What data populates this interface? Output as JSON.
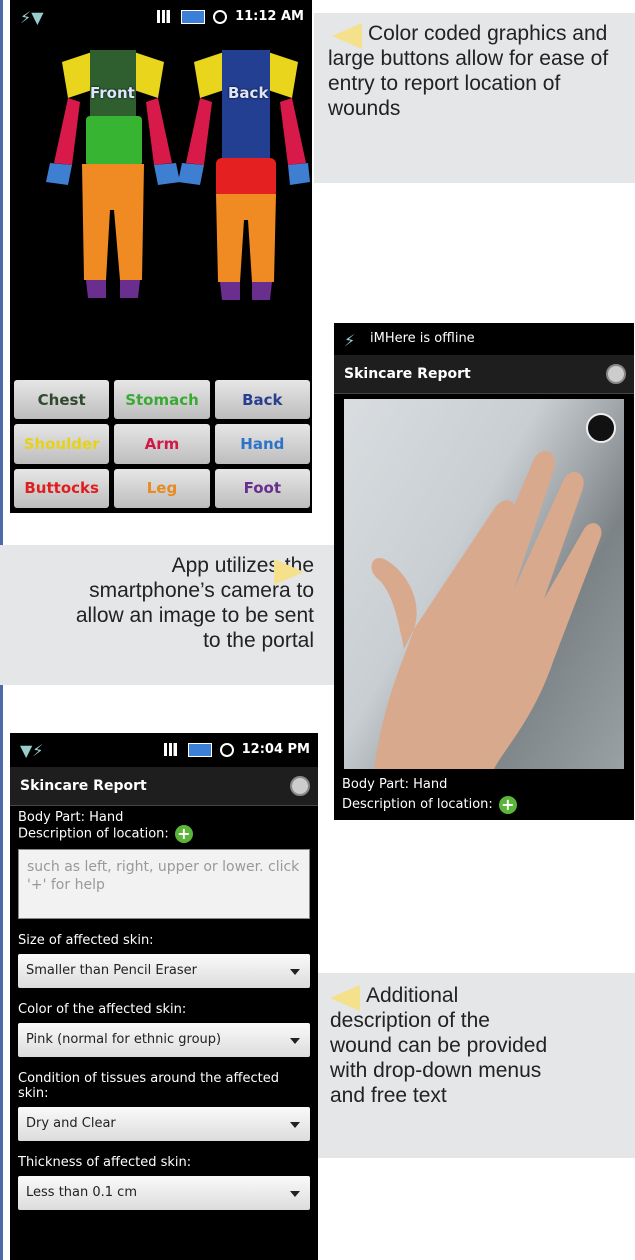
{
  "callouts": {
    "c1": "Color coded graphics and large buttons allow for ease of entry to report location of wounds",
    "c2": "App utilizes the smartphone’s camera to allow an image to be sent to the portal",
    "c3": "Additional description of the wound can be provided with drop-down menus and free text"
  },
  "phone1": {
    "time": "11:12 AM",
    "front_label": "Front",
    "back_label": "Back",
    "buttons": [
      {
        "label": "Chest",
        "color": "#2f4a2f"
      },
      {
        "label": "Stomach",
        "color": "#3aaa35"
      },
      {
        "label": "Back",
        "color": "#2a3e8f"
      },
      {
        "label": "Shoulder",
        "color": "#e6d21a"
      },
      {
        "label": "Arm",
        "color": "#d01a45"
      },
      {
        "label": "Hand",
        "color": "#2e73c9"
      },
      {
        "label": "Buttocks",
        "color": "#e01e1e"
      },
      {
        "label": "Leg",
        "color": "#e88a20"
      },
      {
        "label": "Foot",
        "color": "#6a2e8f"
      }
    ]
  },
  "phone2": {
    "status": "iMHere is offline",
    "title": "Skincare Report",
    "body_part": "Body Part:  Hand",
    "description_label": "Description of location:"
  },
  "phone3": {
    "time": "12:04 PM",
    "title": "Skincare Report",
    "body_part": "Body Part:  Hand",
    "description_label": "Description of location:",
    "description_placeholder": "such as left, right, upper or lower. click '+' for help",
    "fields": [
      {
        "label": "Size of affected skin:",
        "value": "Smaller than Pencil Eraser"
      },
      {
        "label": "Color of the affected skin:",
        "value": "Pink (normal for ethnic group)"
      },
      {
        "label": "Condition of tissues around the affected skin:",
        "value": "Dry and Clear"
      },
      {
        "label": "Thickness of affected skin:",
        "value": "Less than 0.1 cm"
      }
    ]
  }
}
